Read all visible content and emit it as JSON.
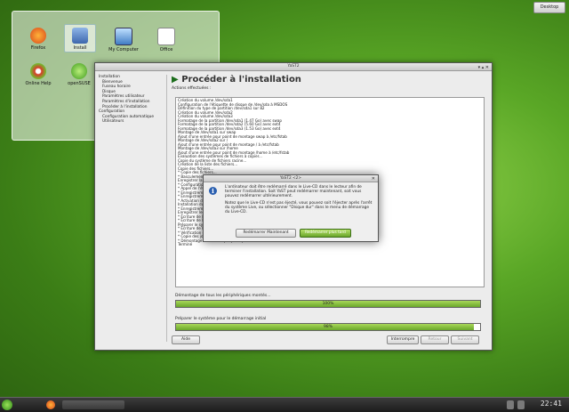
{
  "desktop_button": "Desktop",
  "desktop_icons": [
    {
      "label": "Firefox",
      "icon": "firefox-icon",
      "color": "#e66a1e"
    },
    {
      "label": "Install",
      "icon": "install-icon",
      "color": "#4a6fb0"
    },
    {
      "label": "My Computer",
      "icon": "computer-icon",
      "color": "#5b8fc7"
    },
    {
      "label": "Office",
      "icon": "office-icon",
      "color": "#ffffff"
    },
    {
      "label": "Online Help",
      "icon": "help-icon",
      "color": "#d83a2a"
    },
    {
      "label": "openSUSE",
      "icon": "opensuse-icon",
      "color": "#6bbf2a"
    }
  ],
  "window": {
    "title": "YaST2",
    "heading": "Procéder à l'installation",
    "sidebar": [
      {
        "label": "Installation",
        "sub": false
      },
      {
        "label": "Bienvenue",
        "sub": true
      },
      {
        "label": "Fuseau horaire",
        "sub": true
      },
      {
        "label": "Disque",
        "sub": true
      },
      {
        "label": "Paramètres utilisateur",
        "sub": true
      },
      {
        "label": "Paramètres d'installation",
        "sub": true
      },
      {
        "label": "Procéder à l'installation",
        "sub": true
      },
      {
        "label": "Configuration",
        "sub": false
      },
      {
        "label": "Configuration automatique",
        "sub": true
      },
      {
        "label": "Utilisateurs",
        "sub": true
      }
    ],
    "actions_label": "Actions effectuées :",
    "log": [
      "Création du volume /dev/sda1",
      "Configuration de l'étiquette de disque de /dev/sda à MSDOS",
      "Définition du type de partition /dev/sda1 sur 82",
      "Création du volume /dev/sda2",
      "Création du volume /dev/sda3",
      "Formatage de la partition /dev/sda1 (1.47 Go) avec swap",
      "Formatage de la partition /dev/sda2 (5.60 Go) avec ext4",
      "Formatage de la partition /dev/sda3 (1.53 Go) avec ext4",
      "Montage de /dev/sda1 sur swap",
      "Ajout d'une entrée pour point de montage swap à /etc/fstab",
      "Montage de /dev/sda2 sur /",
      "Ajout d'une entrée pour point de montage / à /etc/fstab",
      "Montage de /dev/sda3 sur /home",
      "Ajout d'une entrée pour point de montage /home à /etc/fstab",
      "Évaluation des systèmes de fichiers à copier...",
      "Copie du système de fichiers racine...",
      "Création de la liste des fichiers...",
      "Copie des fichiers...",
      "* Copie des fichiers...",
      "* Basculement vers le système installé...",
      "Enregistrer la configuration...",
      "* Configuration du réseau...",
      "* Appel de l'étape d'installation...",
      "* Enregistrement des paramètres...",
      "* Enregistrement de la configuration...",
      "* Activation de la configuration...",
      "Installation du chargeur de démarrage...",
      "* Enregistrement de la configuration...",
      "Enregistrer les paramètres...",
      "* Écriture de la configuration...",
      "* Écriture de la configuration automatique",
      "Préparer le système pour le démarrage initial",
      "* Écriture de la configuration de YaST...",
      "* Vérification du système installé...",
      "* Copie des journaux vers le système installé...",
      "* Démontage de tous les périphériques montés...",
      "Terminé"
    ],
    "progress1": {
      "label": "Démontage de tous les périphériques montés...",
      "percent": 100,
      "text": "100%"
    },
    "progress2": {
      "label": "Préparer le système pour le démarrage initial",
      "percent": 98,
      "text": "98%"
    },
    "buttons": {
      "help": "Aide",
      "abort": "Interrompre",
      "back": "Retour",
      "next": "Suivant"
    }
  },
  "dialog": {
    "title": "YaST2 <2>",
    "msg1": "L'ordinateur doit être redémarré dans le Live-CD dans le lecteur afin de terminer l'installation. Soit YaST peut redémarrer maintenant, soit vous pouvez redémarrer ultérieurement.",
    "msg2": "Notez que le Live-CD n'est pas éjecté, vous pouvez soit l'éjecter après l'arrêt du système Live, ou sélectionner \"Disque dur\" dans le menu de démarrage du Live-CD.",
    "reboot_now": "Redémarrer Maintenant",
    "reboot_later": "Redémarrer plus tard"
  },
  "taskbar": {
    "clock": "22:41"
  }
}
